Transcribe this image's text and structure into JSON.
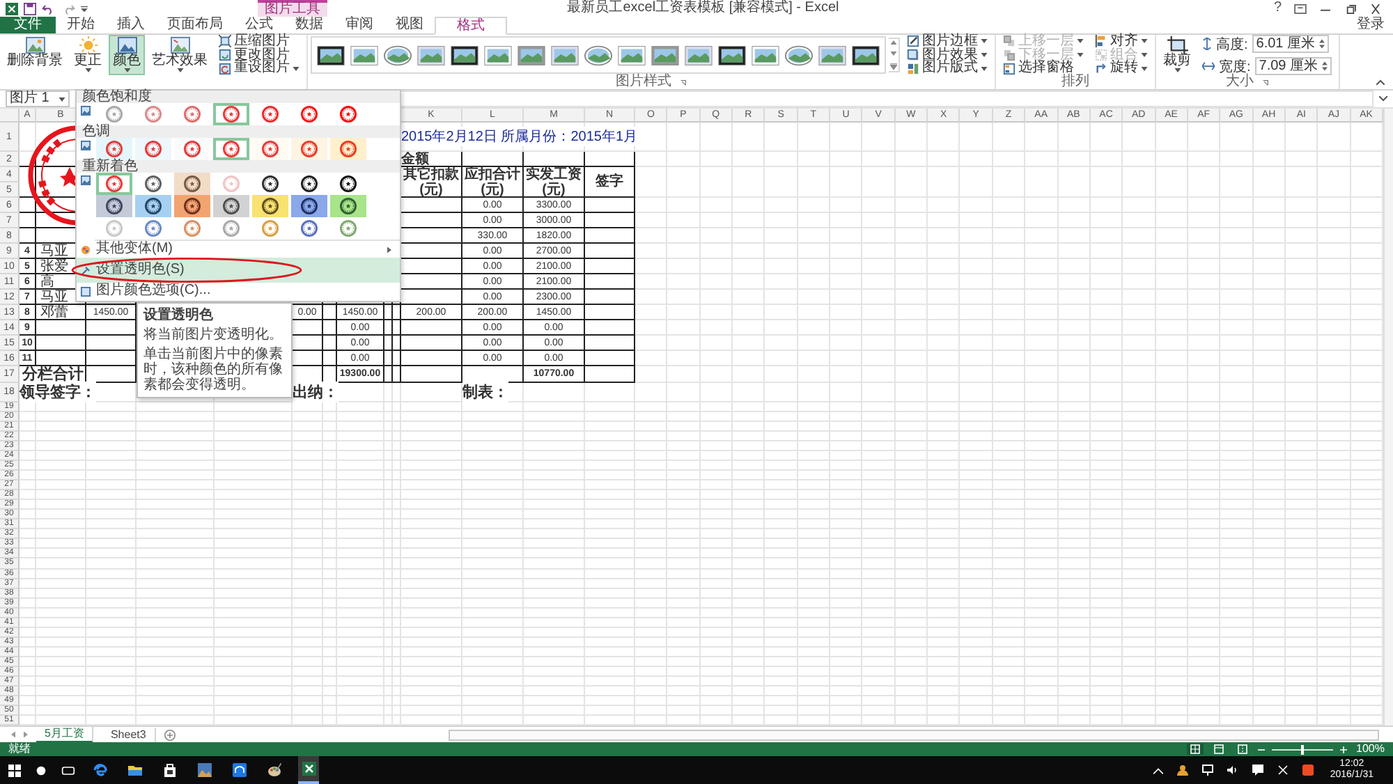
{
  "window": {
    "title": "最新员工excel工资表模板 [兼容模式] - Excel",
    "context_label": "图片工具",
    "help": "?"
  },
  "account": "登录",
  "ribbon_tabs": [
    {
      "label": "文件",
      "kind": "file",
      "selected": false
    },
    {
      "label": "开始",
      "kind": "tab",
      "selected": false
    },
    {
      "label": "插入",
      "kind": "tab",
      "selected": false
    },
    {
      "label": "页面布局",
      "kind": "tab",
      "selected": false
    },
    {
      "label": "公式",
      "kind": "tab",
      "selected": false
    },
    {
      "label": "数据",
      "kind": "tab",
      "selected": false
    },
    {
      "label": "审阅",
      "kind": "tab",
      "selected": false
    },
    {
      "label": "视图",
      "kind": "tab",
      "selected": false
    },
    {
      "label": "格式",
      "kind": "context",
      "selected": true
    }
  ],
  "adjust_buttons": [
    {
      "label": "删除背景",
      "kind": "background",
      "selected": false,
      "dropdown": false
    },
    {
      "label": "更正",
      "kind": "corrections",
      "selected": false,
      "dropdown": true
    },
    {
      "label": "颜色",
      "kind": "color",
      "selected": true,
      "dropdown": true
    },
    {
      "label": "艺术效果",
      "kind": "artistic",
      "selected": false,
      "dropdown": true
    }
  ],
  "adjust_small": [
    {
      "label": "压缩图片",
      "kind": "compress",
      "dropdown": false
    },
    {
      "label": "更改图片",
      "kind": "change",
      "dropdown": false
    },
    {
      "label": "重设图片",
      "kind": "reset",
      "dropdown": true
    }
  ],
  "style_options": [
    {
      "label": "图片边框",
      "kind": "border"
    },
    {
      "label": "图片效果",
      "kind": "effects"
    },
    {
      "label": "图片版式",
      "kind": "layout"
    }
  ],
  "styles_group": "图片样式",
  "arrange": [
    {
      "label": "上移一层",
      "kind": "forward",
      "disabled": true,
      "dropdown": true
    },
    {
      "label": "下移一层",
      "kind": "backward",
      "disabled": true,
      "dropdown": true
    },
    {
      "label": "选择窗格",
      "kind": "pane",
      "disabled": false,
      "dropdown": false
    },
    {
      "label": "对齐",
      "kind": "align",
      "disabled": false,
      "dropdown": true
    },
    {
      "label": "组合",
      "kind": "group",
      "disabled": true,
      "dropdown": true
    },
    {
      "label": "旋转",
      "kind": "rotate",
      "disabled": false,
      "dropdown": true
    }
  ],
  "arrange_group": "排列",
  "crop": "裁剪",
  "size": [
    {
      "label": "高度:",
      "value": "6.01 厘米",
      "kind": "height"
    },
    {
      "label": "宽度:",
      "value": "7.09 厘米",
      "kind": "width"
    }
  ],
  "size_group": "大小",
  "name_box": "图片 1",
  "columns_left": [
    "A",
    "B"
  ],
  "columns_right": [
    "K",
    "L",
    "M",
    "N",
    "O",
    "P",
    "Q",
    "R",
    "S",
    "T",
    "U",
    "V",
    "W",
    "X",
    "Y",
    "Z",
    "AA",
    "AB",
    "AC",
    "AD",
    "AE",
    "AF",
    "AG",
    "AH",
    "AI",
    "AJ",
    "AK"
  ],
  "rows": [
    {
      "number": "1",
      "kind": "title",
      "cells": [
        null,
        null,
        null,
        null,
        null,
        null,
        null,
        null,
        null,
        null,
        "2015年2月12日  所属月份：2015年1月",
        null,
        null,
        null
      ]
    },
    {
      "number": "2",
      "kind": "band",
      "cells": [
        null,
        null,
        null,
        null,
        null,
        null,
        null,
        null,
        null,
        null,
        "金额",
        null,
        null,
        null
      ]
    },
    {
      "number": "4",
      "kind": "header",
      "cells": [
        null,
        null,
        null,
        null,
        null,
        null,
        null,
        null,
        null,
        null,
        "其它扣款(元)",
        "应扣合计(元)",
        "实发工资(元)",
        "签字"
      ]
    },
    {
      "number": "5",
      "kind": "header_cont",
      "cells": []
    },
    {
      "number": "6",
      "kind": "data",
      "cells": [
        null,
        null,
        null,
        null,
        null,
        null,
        null,
        null,
        null,
        null,
        null,
        "0.00",
        "3300.00",
        null
      ]
    },
    {
      "number": "7",
      "kind": "data",
      "cells": [
        null,
        null,
        null,
        null,
        null,
        null,
        null,
        null,
        null,
        null,
        null,
        "0.00",
        "3000.00",
        null
      ]
    },
    {
      "number": "8",
      "kind": "data",
      "cells": [
        null,
        null,
        null,
        null,
        null,
        null,
        null,
        null,
        null,
        null,
        null,
        "330.00",
        "1820.00",
        null
      ]
    },
    {
      "number": "9",
      "kind": "data",
      "cells": [
        "4",
        "马亚",
        null,
        null,
        null,
        null,
        null,
        null,
        null,
        null,
        null,
        "0.00",
        "2700.00",
        null
      ]
    },
    {
      "number": "10",
      "kind": "data",
      "cells": [
        "5",
        "张爱",
        null,
        null,
        null,
        null,
        null,
        null,
        null,
        null,
        null,
        "0.00",
        "2100.00",
        null
      ]
    },
    {
      "number": "11",
      "kind": "data",
      "cells": [
        "6",
        "高",
        null,
        null,
        null,
        null,
        null,
        null,
        null,
        null,
        null,
        "0.00",
        "2100.00",
        null
      ]
    },
    {
      "number": "12",
      "kind": "data",
      "cells": [
        "7",
        "马亚",
        null,
        null,
        null,
        null,
        null,
        null,
        null,
        null,
        null,
        "0.00",
        "2300.00",
        null
      ]
    },
    {
      "number": "13",
      "kind": "data",
      "cells": [
        "8",
        "邓蕾",
        "1450.00",
        null,
        null,
        "0.00",
        null,
        "1450.00",
        null,
        null,
        "200.00",
        "200.00",
        "1450.00",
        null
      ]
    },
    {
      "number": "14",
      "kind": "data",
      "cells": [
        "9",
        null,
        null,
        null,
        null,
        null,
        null,
        "0.00",
        null,
        null,
        null,
        "0.00",
        "0.00",
        null
      ]
    },
    {
      "number": "15",
      "kind": "data",
      "cells": [
        "10",
        null,
        null,
        null,
        null,
        null,
        null,
        "0.00",
        null,
        null,
        null,
        "0.00",
        "0.00",
        null
      ]
    },
    {
      "number": "16",
      "kind": "data",
      "cells": [
        "11",
        null,
        null,
        null,
        null,
        null,
        null,
        "0.00",
        null,
        null,
        null,
        "0.00",
        "0.00",
        null
      ]
    },
    {
      "number": "17",
      "kind": "total",
      "cells": [
        "分栏合计",
        null,
        null,
        null,
        null,
        null,
        null,
        "19300.00",
        null,
        null,
        null,
        null,
        "10770.00",
        null
      ]
    },
    {
      "number": "18",
      "kind": "sign",
      "cells": [
        "领导签字：",
        null,
        null,
        null,
        null,
        "出纳：",
        null,
        null,
        null,
        null,
        null,
        "制表：",
        null,
        null
      ]
    }
  ],
  "blank_rows": [
    "19",
    "20",
    "21",
    "22",
    "23",
    "24",
    "25",
    "26",
    "27",
    "28",
    "29",
    "30",
    "31",
    "32",
    "33",
    "34",
    "35",
    "36",
    "37",
    "38",
    "39",
    "40",
    "41",
    "42",
    "43",
    "44",
    "45",
    "46",
    "47",
    "48",
    "49",
    "50",
    "51"
  ],
  "color_menu": {
    "sections": [
      {
        "title": "颜色饱和度",
        "options": [
          {
            "selected": false,
            "color": "#a8a8a8",
            "tile": {
              "color": "#ffffff"
            }
          },
          {
            "selected": false,
            "color": "#d88a8a",
            "tile": {
              "color": "#ffffff"
            }
          },
          {
            "selected": false,
            "color": "#e46a6a",
            "tile": {
              "color": "#ffffff"
            }
          },
          {
            "selected": true,
            "color": "#e83a3a",
            "tile": {
              "color": "#ffffff"
            }
          },
          {
            "selected": false,
            "color": "#f02a2a",
            "tile": {
              "color": "#ffffff"
            }
          },
          {
            "selected": false,
            "color": "#f61616",
            "tile": {
              "color": "#ffffff"
            }
          },
          {
            "selected": false,
            "color": "#ff0000",
            "tile": {
              "color": "#ffffff"
            }
          }
        ]
      },
      {
        "title": "色调",
        "options": [
          {
            "selected": false,
            "color": "#e23c3c",
            "tile": {
              "color": "#e4f6fb"
            }
          },
          {
            "selected": false,
            "color": "#e23c3c",
            "tile": {
              "color": "#eef7fb"
            }
          },
          {
            "selected": false,
            "color": "#e23c3c",
            "tile": {
              "color": "#fbfbfb"
            }
          },
          {
            "selected": true,
            "color": "#e83a3a",
            "tile": {
              "color": "#ffffff"
            }
          },
          {
            "selected": false,
            "color": "#ea3a3a",
            "tile": {
              "color": "#fffaf2"
            }
          },
          {
            "selected": false,
            "color": "#ee3a2a",
            "tile": {
              "color": "#fff4e2"
            }
          },
          {
            "selected": false,
            "color": "#f03a20",
            "tile": {
              "color": "#fff0cc"
            }
          }
        ]
      },
      {
        "title": "重新着色",
        "options": [
          {
            "selected": true,
            "color": "#e83a3a",
            "tile": {
              "color": "#ffffff"
            }
          },
          {
            "selected": false,
            "color": "#606060",
            "tile": {
              "color": "#ffffff"
            }
          },
          {
            "selected": false,
            "color": "#7a5a44",
            "tile": {
              "color": "#f2dcc8"
            }
          },
          {
            "selected": false,
            "color": "#f0c4c4",
            "tile": {
              "color": "#ffffff"
            }
          },
          {
            "selected": false,
            "color": "#303030",
            "tile": {
              "color": "#ffffff"
            }
          },
          {
            "selected": false,
            "color": "#202020",
            "tile": {
              "color": "#ffffff"
            }
          },
          {
            "selected": false,
            "color": "#101010",
            "tile": {
              "color": "#ffffff"
            }
          },
          {
            "selected": false,
            "color": "#404860",
            "tile": {
              "color": "#c4cad8"
            }
          },
          {
            "selected": false,
            "color": "#244866",
            "tile": {
              "color": "#a6d0f2"
            }
          },
          {
            "selected": false,
            "color": "#703020",
            "tile": {
              "color": "#f2a470"
            }
          },
          {
            "selected": false,
            "color": "#505050",
            "tile": {
              "color": "#d2d2d2"
            }
          },
          {
            "selected": false,
            "color": "#605020",
            "tile": {
              "color": "#f8e270"
            }
          },
          {
            "selected": false,
            "color": "#223066",
            "tile": {
              "color": "#8aa8ea"
            }
          },
          {
            "selected": false,
            "color": "#306030",
            "tile": {
              "color": "#a8e48a"
            }
          },
          {
            "selected": false,
            "color": "#c8c8c8",
            "tile": {
              "color": "#ffffff"
            }
          },
          {
            "selected": false,
            "color": "#6a8ac8",
            "tile": {
              "color": "#ffffff"
            }
          },
          {
            "selected": false,
            "color": "#d89060",
            "tile": {
              "color": "#ffffff"
            }
          },
          {
            "selected": false,
            "color": "#a8a8a8",
            "tile": {
              "color": "#ffffff"
            }
          },
          {
            "selected": false,
            "color": "#d8a040",
            "tile": {
              "color": "#ffffff"
            }
          },
          {
            "selected": false,
            "color": "#5a70c0",
            "tile": {
              "color": "#ffffff"
            }
          },
          {
            "selected": false,
            "color": "#80a870",
            "tile": {
              "color": "#ffffff"
            }
          }
        ]
      }
    ],
    "items": [
      {
        "label": "其他变体(M)",
        "kind": "variations",
        "selected": false,
        "submenu": true
      },
      {
        "label": "设置透明色(S)",
        "kind": "transparent",
        "selected": true,
        "submenu": false
      },
      {
        "label": "图片颜色选项(C)...",
        "kind": "options",
        "selected": false,
        "submenu": false
      }
    ]
  },
  "tooltip": {
    "title": "设置透明色",
    "lines": [
      "将当前图片变透明化。",
      "单击当前图片中的像素时，该种颜色的所有像素都会变得透明。"
    ]
  },
  "sheet_tabs": [
    {
      "label": "5月工资",
      "selected": true
    },
    {
      "label": "Sheet3",
      "selected": false
    }
  ],
  "status_bar": {
    "text": "就绪",
    "zoom": "100%",
    "zoom_slider": {
      "level": 0.5
    },
    "views": [
      {
        "kind": "normal",
        "selected": true
      },
      {
        "kind": "layout",
        "selected": false
      },
      {
        "kind": "pagebreak",
        "selected": false
      }
    ]
  },
  "taskbar": {
    "apps": [
      {
        "kind": "edge",
        "active": false
      },
      {
        "kind": "explorer",
        "active": false
      },
      {
        "kind": "store",
        "active": false
      },
      {
        "kind": "photos",
        "active": false
      },
      {
        "kind": "app",
        "active": false
      },
      {
        "kind": "paint",
        "active": false
      },
      {
        "kind": "excel",
        "active": true
      }
    ],
    "time": "12:02",
    "date": "2016/1/31"
  }
}
